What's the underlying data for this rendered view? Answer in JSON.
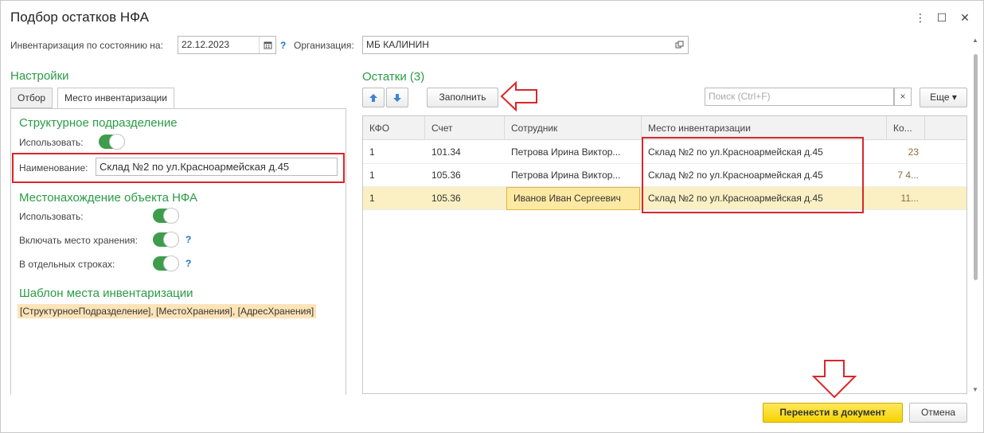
{
  "window": {
    "title": "Подбор остатков НФА",
    "menu_icon": "⋮",
    "maximize_icon": "☐",
    "close_icon": "✕"
  },
  "header": {
    "inventory_label": "Инвентаризация по состоянию на:",
    "inventory_date": "22.12.2023",
    "help_mark": "?",
    "org_label": "Организация:",
    "org_value": "МБ КАЛИНИН"
  },
  "settings": {
    "title": "Настройки",
    "tabs": [
      {
        "label": "Отбор",
        "active": false
      },
      {
        "label": "Место инвентаризации",
        "active": true
      }
    ],
    "struct_title": "Структурное подразделение",
    "use_label": "Использовать:",
    "name_label": "Наименование:",
    "name_value": "Склад №2 по ул.Красноармейская д.45",
    "location_title": "Местонахождение объекта НФА",
    "loc_use_label": "Использовать:",
    "include_storage_label": "Включать место хранения:",
    "separate_rows_label": "В отдельных строках:",
    "template_title": "Шаблон места инвентаризации",
    "template_value": "[СтруктурноеПодразделение], [МестоХранения], [АдресХранения]"
  },
  "balances": {
    "title": "Остатки (3)",
    "fill_button": "Заполнить",
    "search_placeholder": "Поиск (Ctrl+F)",
    "clear_icon": "×",
    "more_button": "Еще ▾",
    "columns": [
      "КФО",
      "Счет",
      "Сотрудник",
      "Место инвентаризации",
      "Ко..."
    ],
    "rows": [
      {
        "kfo": "1",
        "account": "101.34",
        "employee": "Петрова Ирина Виктор...",
        "place": "Склад №2 по ул.Красноармейская д.45",
        "qty": "23",
        "selected": false
      },
      {
        "kfo": "1",
        "account": "105.36",
        "employee": "Петрова Ирина Виктор...",
        "place": "Склад №2 по ул.Красноармейская д.45",
        "qty": "7 4...",
        "selected": false
      },
      {
        "kfo": "1",
        "account": "105.36",
        "employee": "Иванов Иван Сергеевич",
        "place": "Склад №2 по ул.Красноармейская д.45",
        "qty": "11...",
        "selected": true
      }
    ]
  },
  "footer": {
    "transfer_button": "Перенести в документ",
    "cancel_button": "Отмена"
  },
  "colors": {
    "accent_green": "#2a9c45",
    "highlight_red": "#d9262b",
    "primary_yellow": "#f5d300",
    "selected_row": "#fbf0c4"
  }
}
